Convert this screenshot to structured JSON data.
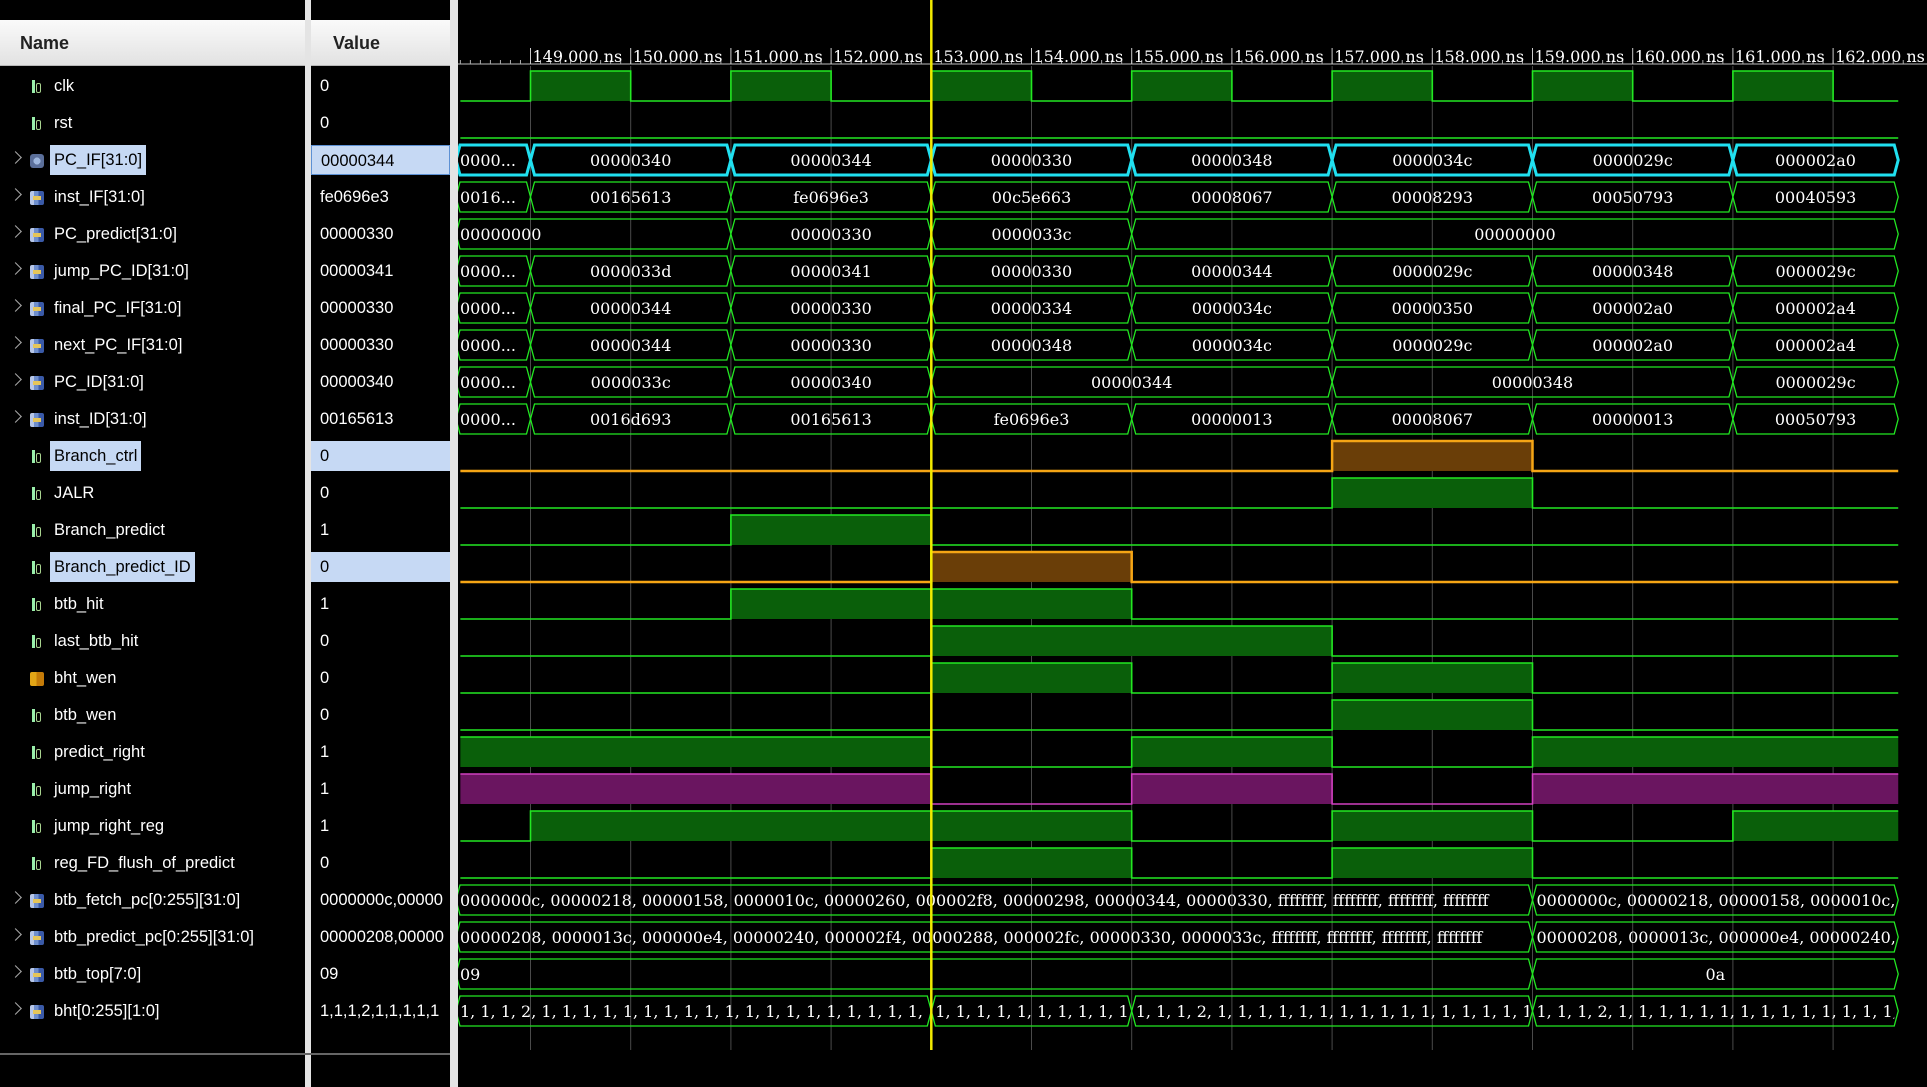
{
  "columns": {
    "name": "Name",
    "value": "Value"
  },
  "colors": {
    "background": "#000000",
    "bit_high_fill": "#0a5f0a",
    "bit_line": "#22e822",
    "bus_outline": "#22e822",
    "selected_bus": "#20e0f0",
    "selected_bit_fill": "#6a3e08",
    "selected_bit_line": "#f5a515",
    "magenta_fill": "#6a1560",
    "magenta_line": "#d040c0",
    "cursor": "#f2ea00",
    "selection_bg": "#c6d9f4",
    "grid": "#4a4a4a"
  },
  "signals": [
    {
      "name": "clk",
      "value": "0",
      "icon": "bit-signal-icon",
      "expandable": false,
      "selected": false
    },
    {
      "name": "rst",
      "value": "0",
      "icon": "bit-signal-icon",
      "expandable": false,
      "selected": false
    },
    {
      "name": "PC_IF[31:0]",
      "value": "00000344",
      "icon": "pc-bus-icon",
      "expandable": true,
      "selected": true
    },
    {
      "name": "inst_IF[31:0]",
      "value": "fe0696e3",
      "icon": "bus-signal-icon",
      "expandable": true,
      "selected": false
    },
    {
      "name": "PC_predict[31:0]",
      "value": "00000330",
      "icon": "bus-signal-icon",
      "expandable": true,
      "selected": false
    },
    {
      "name": "jump_PC_ID[31:0]",
      "value": "00000341",
      "icon": "bus-signal-icon",
      "expandable": true,
      "selected": false
    },
    {
      "name": "final_PC_IF[31:0]",
      "value": "00000330",
      "icon": "bus-signal-icon",
      "expandable": true,
      "selected": false
    },
    {
      "name": "next_PC_IF[31:0]",
      "value": "00000330",
      "icon": "bus-signal-icon",
      "expandable": true,
      "selected": false
    },
    {
      "name": "PC_ID[31:0]",
      "value": "00000340",
      "icon": "bus-signal-icon",
      "expandable": true,
      "selected": false
    },
    {
      "name": "inst_ID[31:0]",
      "value": "00165613",
      "icon": "bus-signal-icon",
      "expandable": true,
      "selected": false
    },
    {
      "name": "Branch_ctrl",
      "value": "0",
      "icon": "bit-signal-icon",
      "expandable": false,
      "selected": true
    },
    {
      "name": "JALR",
      "value": "0",
      "icon": "bit-signal-icon",
      "expandable": false,
      "selected": false
    },
    {
      "name": "Branch_predict",
      "value": "1",
      "icon": "bit-signal-icon",
      "expandable": false,
      "selected": false
    },
    {
      "name": "Branch_predict_ID",
      "value": "0",
      "icon": "bit-signal-icon",
      "expandable": false,
      "selected": true
    },
    {
      "name": "btb_hit",
      "value": "1",
      "icon": "bit-signal-icon",
      "expandable": false,
      "selected": false
    },
    {
      "name": "last_btb_hit",
      "value": "0",
      "icon": "bit-signal-icon",
      "expandable": false,
      "selected": false
    },
    {
      "name": "bht_wen",
      "value": "0",
      "icon": "bht-wen-icon",
      "expandable": false,
      "selected": false
    },
    {
      "name": "btb_wen",
      "value": "0",
      "icon": "bit-signal-icon",
      "expandable": false,
      "selected": false
    },
    {
      "name": "predict_right",
      "value": "1",
      "icon": "bit-signal-icon",
      "expandable": false,
      "selected": false
    },
    {
      "name": "jump_right",
      "value": "1",
      "icon": "bit-signal-icon",
      "expandable": false,
      "selected": false
    },
    {
      "name": "jump_right_reg",
      "value": "1",
      "icon": "bit-signal-icon",
      "expandable": false,
      "selected": false
    },
    {
      "name": "reg_FD_flush_of_predict",
      "value": "0",
      "icon": "bit-signal-icon",
      "expandable": false,
      "selected": false
    },
    {
      "name": "btb_fetch_pc[0:255][31:0]",
      "value": "0000000c,00000",
      "icon": "bus-signal-icon",
      "expandable": true,
      "selected": false
    },
    {
      "name": "btb_predict_pc[0:255][31:0]",
      "value": "00000208,00000",
      "icon": "bus-signal-icon",
      "expandable": true,
      "selected": false
    },
    {
      "name": "btb_top[7:0]",
      "value": "09",
      "icon": "bus-signal-icon",
      "expandable": true,
      "selected": false
    },
    {
      "name": "bht[0:255][1:0]",
      "value": "1,1,1,2,1,1,1,1,1",
      "icon": "bus-signal-icon",
      "expandable": true,
      "selected": false
    }
  ],
  "timeline": {
    "ticks": [
      "149.000 ns",
      "150.000 ns",
      "151.000 ns",
      "152.000 ns",
      "153.000 ns",
      "154.000 ns",
      "155.000 ns",
      "156.000 ns",
      "157.000 ns",
      "158.000 ns",
      "159.000 ns",
      "160.000 ns",
      "161.000 ns",
      "162.000 ns"
    ],
    "cursor": "153.000 ns"
  },
  "waves": [
    {
      "kind": "bit",
      "style": "clk",
      "segments": [
        [
          148.3,
          149,
          0
        ],
        [
          149,
          150,
          1
        ],
        [
          150,
          151,
          0
        ],
        [
          151,
          152,
          1
        ],
        [
          152,
          153,
          0
        ],
        [
          153,
          154,
          1
        ],
        [
          154,
          155,
          0
        ],
        [
          155,
          156,
          1
        ],
        [
          156,
          157,
          0
        ],
        [
          157,
          158,
          1
        ],
        [
          158,
          159,
          0
        ],
        [
          159,
          160,
          1
        ],
        [
          160,
          161,
          0
        ],
        [
          161,
          162,
          1
        ],
        [
          162,
          162.65,
          0
        ]
      ]
    },
    {
      "kind": "bit",
      "style": "green",
      "segments": [
        [
          148.3,
          162.65,
          0
        ]
      ]
    },
    {
      "kind": "bus",
      "style": "cyan",
      "segments": [
        [
          148.3,
          149,
          "0000..."
        ],
        [
          149,
          151,
          "00000340"
        ],
        [
          151,
          153,
          "00000344"
        ],
        [
          153,
          155,
          "00000330"
        ],
        [
          155,
          157,
          "00000348"
        ],
        [
          157,
          159,
          "0000034c"
        ],
        [
          159,
          161,
          "0000029c"
        ],
        [
          161,
          162.65,
          "000002a0"
        ]
      ]
    },
    {
      "kind": "bus",
      "style": "green",
      "segments": [
        [
          148.3,
          149,
          "0016..."
        ],
        [
          149,
          151,
          "00165613"
        ],
        [
          151,
          153,
          "fe0696e3"
        ],
        [
          153,
          155,
          "00c5e663"
        ],
        [
          155,
          157,
          "00008067"
        ],
        [
          157,
          159,
          "00008293"
        ],
        [
          159,
          161,
          "00050793"
        ],
        [
          161,
          162.65,
          "00040593"
        ]
      ]
    },
    {
      "kind": "bus",
      "style": "green",
      "segments": [
        [
          148.3,
          151,
          "00000000"
        ],
        [
          151,
          153,
          "00000330"
        ],
        [
          153,
          155,
          "0000033c"
        ],
        [
          155,
          162.65,
          "00000000"
        ]
      ]
    },
    {
      "kind": "bus",
      "style": "green",
      "segments": [
        [
          148.3,
          149,
          "0000..."
        ],
        [
          149,
          151,
          "0000033d"
        ],
        [
          151,
          153,
          "00000341"
        ],
        [
          153,
          155,
          "00000330"
        ],
        [
          155,
          157,
          "00000344"
        ],
        [
          157,
          159,
          "0000029c"
        ],
        [
          159,
          161,
          "00000348"
        ],
        [
          161,
          162.65,
          "0000029c"
        ]
      ]
    },
    {
      "kind": "bus",
      "style": "green",
      "segments": [
        [
          148.3,
          149,
          "0000..."
        ],
        [
          149,
          151,
          "00000344"
        ],
        [
          151,
          153,
          "00000330"
        ],
        [
          153,
          155,
          "00000334"
        ],
        [
          155,
          157,
          "0000034c"
        ],
        [
          157,
          159,
          "00000350"
        ],
        [
          159,
          161,
          "000002a0"
        ],
        [
          161,
          162.65,
          "000002a4"
        ]
      ]
    },
    {
      "kind": "bus",
      "style": "green",
      "segments": [
        [
          148.3,
          149,
          "0000..."
        ],
        [
          149,
          151,
          "00000344"
        ],
        [
          151,
          153,
          "00000330"
        ],
        [
          153,
          155,
          "00000348"
        ],
        [
          155,
          157,
          "0000034c"
        ],
        [
          157,
          159,
          "0000029c"
        ],
        [
          159,
          161,
          "000002a0"
        ],
        [
          161,
          162.65,
          "000002a4"
        ]
      ]
    },
    {
      "kind": "bus",
      "style": "green",
      "segments": [
        [
          148.3,
          149,
          "0000..."
        ],
        [
          149,
          151,
          "0000033c"
        ],
        [
          151,
          153,
          "00000340"
        ],
        [
          153,
          157,
          "00000344"
        ],
        [
          157,
          161,
          "00000348"
        ],
        [
          161,
          162.65,
          "0000029c"
        ]
      ]
    },
    {
      "kind": "bus",
      "style": "green",
      "segments": [
        [
          148.3,
          149,
          "0000..."
        ],
        [
          149,
          151,
          "0016d693"
        ],
        [
          151,
          153,
          "00165613"
        ],
        [
          153,
          155,
          "fe0696e3"
        ],
        [
          155,
          157,
          "00000013"
        ],
        [
          157,
          159,
          "00008067"
        ],
        [
          159,
          161,
          "00000013"
        ],
        [
          161,
          162.65,
          "00050793"
        ]
      ]
    },
    {
      "kind": "bit",
      "style": "orange",
      "segments": [
        [
          148.3,
          157,
          0
        ],
        [
          157,
          159,
          1
        ],
        [
          159,
          162.65,
          0
        ]
      ]
    },
    {
      "kind": "bit",
      "style": "green",
      "segments": [
        [
          148.3,
          157,
          0
        ],
        [
          157,
          159,
          1
        ],
        [
          159,
          162.65,
          0
        ]
      ]
    },
    {
      "kind": "bit",
      "style": "green",
      "segments": [
        [
          148.3,
          151,
          0
        ],
        [
          151,
          153,
          1
        ],
        [
          153,
          162.65,
          0
        ]
      ]
    },
    {
      "kind": "bit",
      "style": "orange",
      "segments": [
        [
          148.3,
          153,
          0
        ],
        [
          153,
          155,
          1
        ],
        [
          155,
          162.65,
          0
        ]
      ]
    },
    {
      "kind": "bit",
      "style": "green",
      "segments": [
        [
          148.3,
          151,
          0
        ],
        [
          151,
          155,
          1
        ],
        [
          155,
          162.65,
          0
        ]
      ]
    },
    {
      "kind": "bit",
      "style": "green",
      "segments": [
        [
          148.3,
          153,
          0
        ],
        [
          153,
          157,
          1
        ],
        [
          157,
          162.65,
          0
        ]
      ]
    },
    {
      "kind": "bit",
      "style": "green",
      "segments": [
        [
          148.3,
          153,
          0
        ],
        [
          153,
          155,
          1
        ],
        [
          155,
          157,
          0
        ],
        [
          157,
          159,
          1
        ],
        [
          159,
          162.65,
          0
        ]
      ]
    },
    {
      "kind": "bit",
      "style": "green",
      "segments": [
        [
          148.3,
          157,
          0
        ],
        [
          157,
          159,
          1
        ],
        [
          159,
          162.65,
          0
        ]
      ]
    },
    {
      "kind": "bit",
      "style": "green",
      "segments": [
        [
          148.3,
          153,
          1
        ],
        [
          153,
          155,
          0
        ],
        [
          155,
          157,
          1
        ],
        [
          157,
          159,
          0
        ],
        [
          159,
          162.65,
          1
        ]
      ]
    },
    {
      "kind": "bit",
      "style": "magenta",
      "segments": [
        [
          148.3,
          153,
          1
        ],
        [
          153,
          155,
          0
        ],
        [
          155,
          157,
          1
        ],
        [
          157,
          159,
          0
        ],
        [
          159,
          162.65,
          1
        ]
      ]
    },
    {
      "kind": "bit",
      "style": "green",
      "segments": [
        [
          148.3,
          149,
          0
        ],
        [
          149,
          155,
          1
        ],
        [
          155,
          157,
          0
        ],
        [
          157,
          159,
          1
        ],
        [
          159,
          161,
          0
        ],
        [
          161,
          162.65,
          1
        ]
      ]
    },
    {
      "kind": "bit",
      "style": "green",
      "segments": [
        [
          148.3,
          153,
          0
        ],
        [
          153,
          155,
          1
        ],
        [
          155,
          157,
          0
        ],
        [
          157,
          159,
          1
        ],
        [
          159,
          162.65,
          0
        ]
      ]
    },
    {
      "kind": "bus",
      "style": "array",
      "segments": [
        [
          148.3,
          159,
          "0000000c, 00000218, 00000158, 0000010c, 00000260, 000002f8, 00000298, 00000344, 00000330, ffffffff, ffffffff, ffffffff, ffffffff"
        ],
        [
          159,
          162.65,
          "0000000c, 00000218, 00000158, 0000010c, 00000260"
        ]
      ]
    },
    {
      "kind": "bus",
      "style": "array",
      "segments": [
        [
          148.3,
          159,
          "00000208, 0000013c, 000000e4, 00000240, 000002f4, 00000288, 000002fc, 00000330, 0000033c, ffffffff, ffffffff, ffffffff, ffffffff"
        ],
        [
          159,
          162.65,
          "00000208, 0000013c, 000000e4, 00000240, 000002"
        ]
      ]
    },
    {
      "kind": "bus",
      "style": "green",
      "segments": [
        [
          148.3,
          159,
          "09"
        ],
        [
          159,
          162.65,
          "0a"
        ]
      ]
    },
    {
      "kind": "bus",
      "style": "array",
      "segments": [
        [
          148.3,
          153,
          "1, 1, 1, 2, 1, 1, 1, 1, 1, 1, 1, 1, 1, 1, 1, 1, 1, 1, 1, 1, 1, 1, 1, 1, 1, 1"
        ],
        [
          153,
          155,
          "1, 1, 1, 1, 1, 1, 1, 1, 1, 1, 1, 1, 1, 1, 1, 1"
        ],
        [
          155,
          159,
          "1, 1, 1, 2, 1, 1, 1, 1, 1, 1, 1, 1, 1, 1, 1, 1, 1, 1, 1, 1, 1, 1, 1, 1, ..."
        ],
        [
          159,
          162.65,
          "1, 1, 1, 2, 1, 1, 1, 1, 1, 1, 1, 1, 1, 1, 1, 1, 1, 1, 1, 1, 1, 1, 1, 1, 1"
        ]
      ]
    }
  ]
}
